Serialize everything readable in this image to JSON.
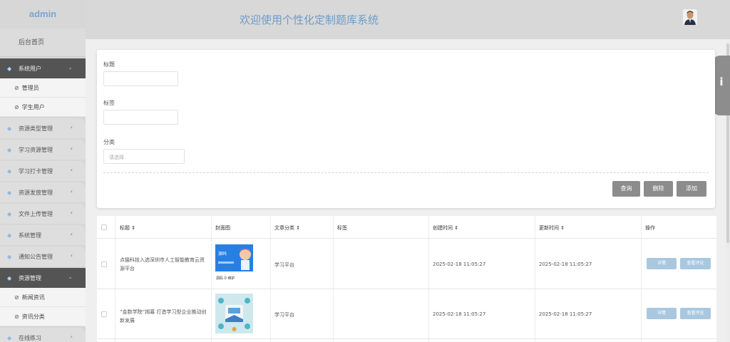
{
  "brand": "admin",
  "header": {
    "title": "欢迎使用个性化定制题库系统"
  },
  "sidebar": {
    "home": "后台首页",
    "groups": [
      {
        "label": "系统用户",
        "active": true,
        "subs": [
          "管理员",
          "学生用户"
        ]
      },
      {
        "label": "资源类型管理"
      },
      {
        "label": "学习资源管理"
      },
      {
        "label": "学习打卡管理"
      },
      {
        "label": "资源发放管理"
      },
      {
        "label": "文件上传管理"
      },
      {
        "label": "系统管理"
      },
      {
        "label": "通知公告管理"
      },
      {
        "label": "资源管理",
        "active": true,
        "subs": [
          "新闻资讯",
          "资讯分类"
        ]
      },
      {
        "label": "在线练习"
      }
    ]
  },
  "info_tab": "i",
  "search": {
    "title_label": "标题",
    "tag_label": "标签",
    "category_label": "分类",
    "category_placeholder": "请选择",
    "buttons": {
      "query": "查询",
      "delete": "删除",
      "add": "添加"
    }
  },
  "table": {
    "columns": [
      "标题",
      "封面图",
      "文章分类",
      "标签",
      "创建时间",
      "更新时间",
      "操作"
    ],
    "rows": [
      {
        "title": "点猫科技入选深圳市人工智能教育云资源平台",
        "cover_caption": "源码 0 维护",
        "cover_text": "源码",
        "category": "学习平台",
        "tags": "",
        "created": "2025-02-18 11:05:27",
        "updated": "2025-02-18 11:05:27",
        "btn1": "详情",
        "btn2": "查看评论"
      },
      {
        "title": "“金数学院”揭幕 打造学习型企业推动创新发展",
        "cover_caption": "",
        "cover_text": "",
        "category": "学习平台",
        "tags": "",
        "created": "2025-02-18 11:05:27",
        "updated": "2025-02-18 11:05:27",
        "btn1": "详情",
        "btn2": "查看评论"
      }
    ]
  },
  "colors": {
    "accent": "#6d9cc8",
    "sidebar_active": "#545454",
    "button_gray": "#8c8c8c",
    "row_button": "#a9c8e0"
  }
}
